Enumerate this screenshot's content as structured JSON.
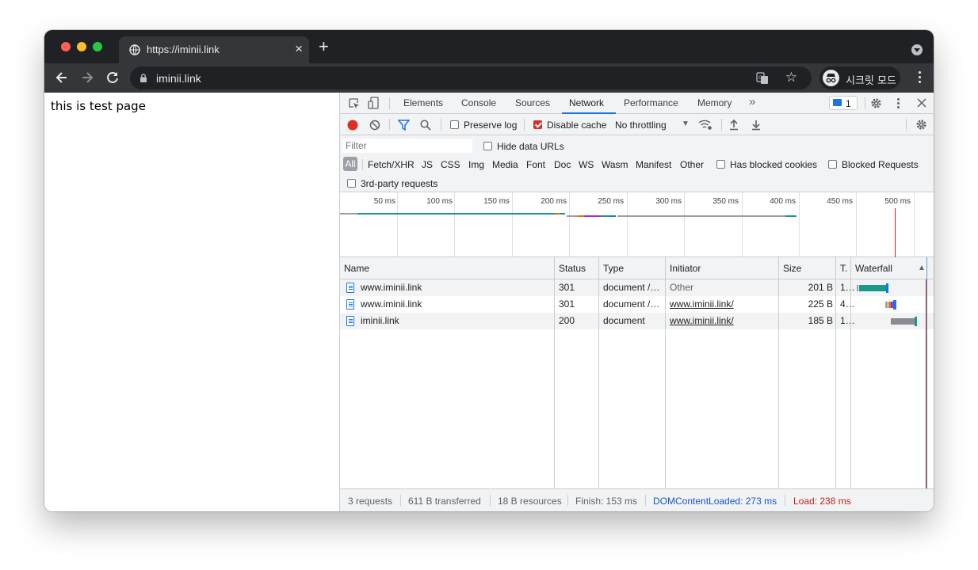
{
  "browser": {
    "tab_title": "https://iminii.link",
    "url": "iminii.link",
    "profile_label": "시크릿 모드"
  },
  "page": {
    "content_text": "this is test page"
  },
  "devtools": {
    "panel_tabs": [
      "Elements",
      "Console",
      "Sources",
      "Network",
      "Performance",
      "Memory"
    ],
    "more_tabs_label": "»",
    "issues_count": "1",
    "toolbar": {
      "preserve_log_label": "Preserve log",
      "preserve_log_checked": false,
      "disable_cache_label": "Disable cache",
      "disable_cache_checked": true,
      "throttling_value": "No throttling"
    },
    "filter": {
      "placeholder": "Filter",
      "hide_data_urls_label": "Hide data URLs",
      "type_filters": [
        "All",
        "Fetch/XHR",
        "JS",
        "CSS",
        "Img",
        "Media",
        "Font",
        "Doc",
        "WS",
        "Wasm",
        "Manifest",
        "Other"
      ],
      "has_blocked_cookies_label": "Has blocked cookies",
      "blocked_requests_label": "Blocked Requests",
      "third_party_label": "3rd-party requests"
    },
    "overview": {
      "tick_labels": [
        "50 ms",
        "100 ms",
        "150 ms",
        "200 ms",
        "250 ms",
        "300 ms",
        "350 ms",
        "400 ms",
        "450 ms",
        "500 ms"
      ]
    },
    "table": {
      "headers": {
        "name": "Name",
        "status": "Status",
        "type": "Type",
        "initiator": "Initiator",
        "size": "Size",
        "time": "T.",
        "waterfall": "Waterfall"
      },
      "sort_indicator": "▲",
      "rows": [
        {
          "name": "www.iminii.link",
          "status": "301",
          "type": "document /…",
          "initiator": "Other",
          "initiator_is_link": false,
          "size": "201 B",
          "time": "1…"
        },
        {
          "name": "www.iminii.link",
          "status": "301",
          "type": "document /…",
          "initiator": "www.iminii.link/",
          "initiator_is_link": true,
          "size": "225 B",
          "time": "4…"
        },
        {
          "name": "iminii.link",
          "status": "200",
          "type": "document",
          "initiator": "www.iminii.link/",
          "initiator_is_link": true,
          "size": "185 B",
          "time": "1…"
        }
      ]
    },
    "summary": {
      "requests": "3 requests",
      "transferred": "611 B transferred",
      "resources": "18 B resources",
      "finish": "Finish: 153 ms",
      "dom_content_loaded": "DOMContentLoaded: 273 ms",
      "load": "Load: 238 ms"
    }
  },
  "colors": {
    "accent": "#1a73e8",
    "dcl_blue": "#1a56c4",
    "load_red": "#c5221f",
    "record_red": "#d93025",
    "bar_teal": "#1a998a"
  }
}
